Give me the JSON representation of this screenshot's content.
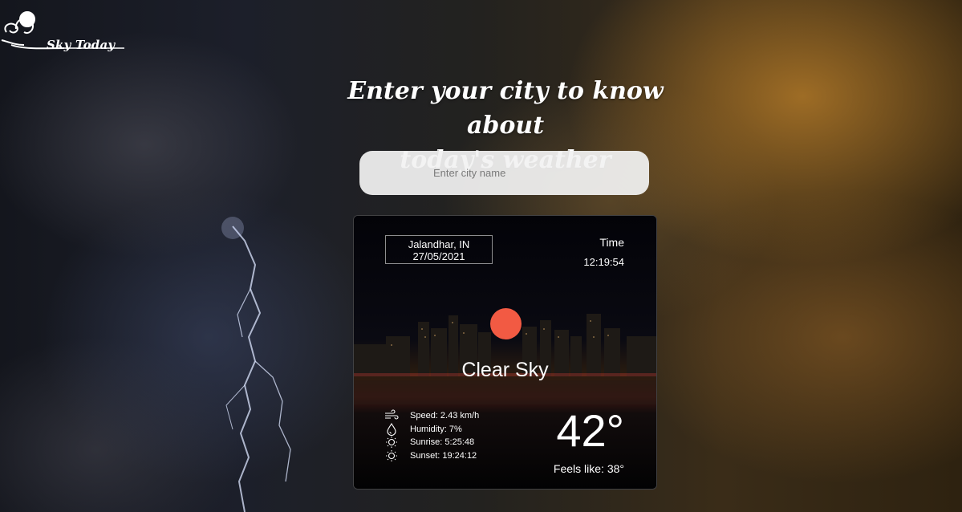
{
  "brand": {
    "name": "Sky Today"
  },
  "headline": {
    "line1": "Enter your city to know about",
    "line2": "today's weather"
  },
  "search": {
    "placeholder": "Enter city name",
    "value": ""
  },
  "weather": {
    "location": "Jalandhar, IN",
    "date": "27/05/2021",
    "time_label": "Time",
    "time": "12:19:54",
    "condition": "Clear Sky",
    "temperature": "42°",
    "feels_like": "Feels like: 38°",
    "stats": [
      {
        "icon": "wind-icon",
        "text": "Speed: 2.43 km/h"
      },
      {
        "icon": "humidity-icon",
        "text": "Humidity: 7%"
      },
      {
        "icon": "sunrise-icon",
        "text": "Sunrise: 5:25:48"
      },
      {
        "icon": "sunset-icon",
        "text": "Sunset: 19:24:12"
      }
    ]
  },
  "colors": {
    "sun": "#f25a43",
    "card_bg": "#020205",
    "text": "#ffffff"
  }
}
